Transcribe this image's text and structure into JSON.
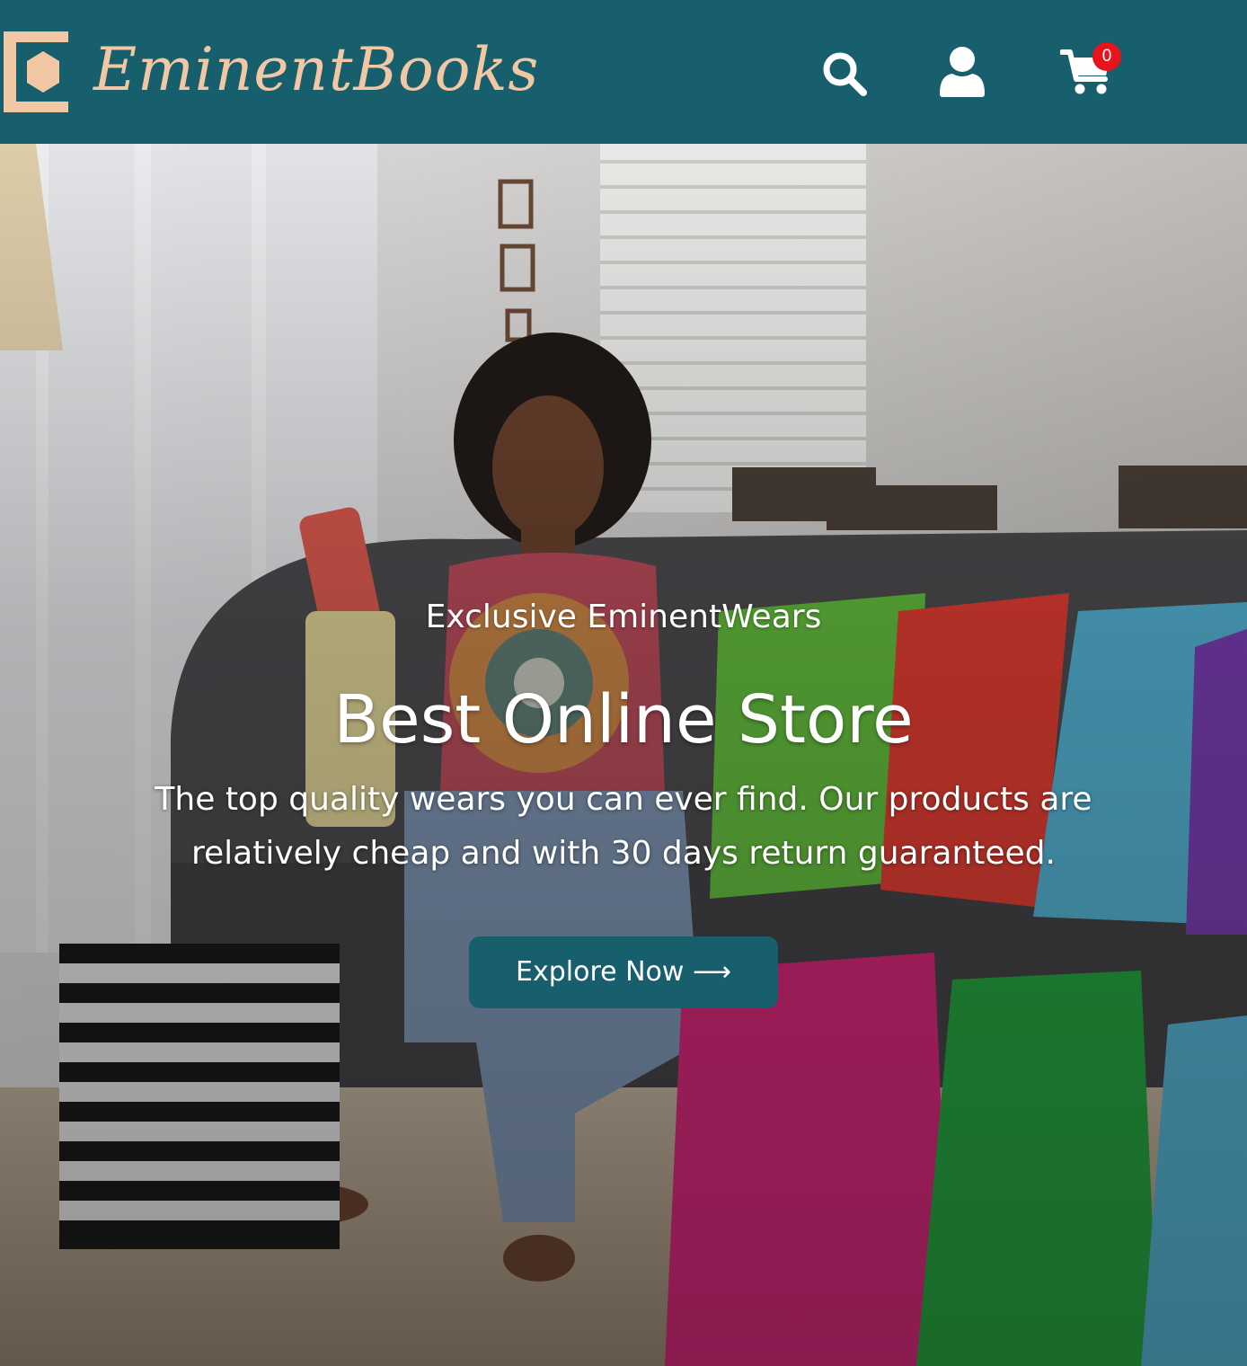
{
  "header": {
    "brand_name": "EminentBooks",
    "cart_count": "0",
    "icons": {
      "logo": "eminentbooks-logo",
      "search": "search-icon",
      "account": "user-icon",
      "cart": "cart-icon"
    }
  },
  "hero": {
    "subtitle": "Exclusive EminentWears",
    "title": "Best Online Store",
    "description": "The top quality wears you can ever find. Our products are relatively cheap and with 30 days return guaranteed.",
    "cta_label": "Explore Now ⟶"
  },
  "colors": {
    "header_bg": "#185f6d",
    "brand": "#f2c7a4",
    "cta_bg": "#185f6d",
    "badge_bg": "#e8141c"
  }
}
